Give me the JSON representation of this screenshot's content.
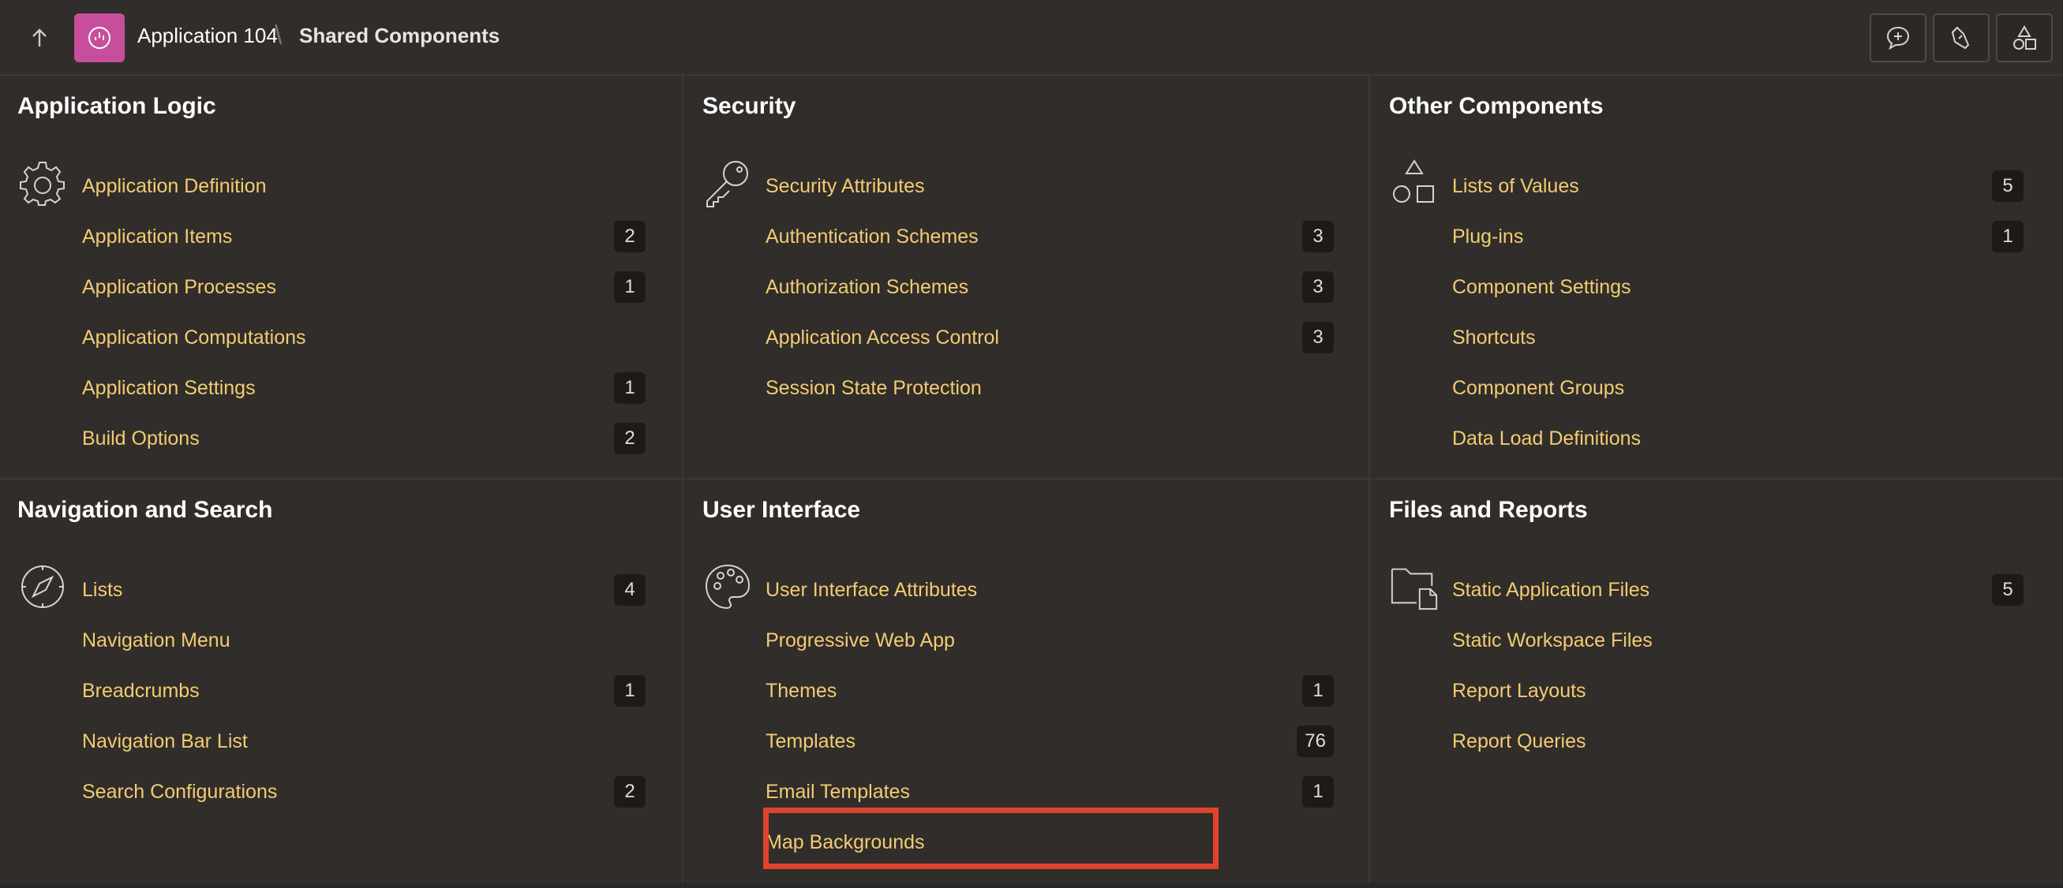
{
  "header": {
    "app_name": "Application 104",
    "separator": "\\",
    "current_page": "Shared Components",
    "buttons": [
      "comment-add-icon",
      "flashlight-icon",
      "shapes-icon"
    ]
  },
  "panels": {
    "application_logic": {
      "title": "Application Logic",
      "icon": "gear-icon",
      "items": [
        {
          "label": "Application Definition",
          "count": ""
        },
        {
          "label": "Application Items",
          "count": "2"
        },
        {
          "label": "Application Processes",
          "count": "1"
        },
        {
          "label": "Application Computations",
          "count": ""
        },
        {
          "label": "Application Settings",
          "count": "1"
        },
        {
          "label": "Build Options",
          "count": "2"
        }
      ]
    },
    "security": {
      "title": "Security",
      "icon": "key-icon",
      "items": [
        {
          "label": "Security Attributes",
          "count": ""
        },
        {
          "label": "Authentication Schemes",
          "count": "3"
        },
        {
          "label": "Authorization Schemes",
          "count": "3"
        },
        {
          "label": "Application Access Control",
          "count": "3"
        },
        {
          "label": "Session State Protection",
          "count": ""
        }
      ]
    },
    "other_components": {
      "title": "Other Components",
      "icon": "shapes-icon",
      "items": [
        {
          "label": "Lists of Values",
          "count": "5"
        },
        {
          "label": "Plug-ins",
          "count": "1"
        },
        {
          "label": "Component Settings",
          "count": ""
        },
        {
          "label": "Shortcuts",
          "count": ""
        },
        {
          "label": "Component Groups",
          "count": ""
        },
        {
          "label": "Data Load Definitions",
          "count": ""
        }
      ]
    },
    "navigation_search": {
      "title": "Navigation and Search",
      "icon": "compass-icon",
      "items": [
        {
          "label": "Lists",
          "count": "4"
        },
        {
          "label": "Navigation Menu",
          "count": ""
        },
        {
          "label": "Breadcrumbs",
          "count": "1"
        },
        {
          "label": "Navigation Bar List",
          "count": ""
        },
        {
          "label": "Search Configurations",
          "count": "2"
        }
      ]
    },
    "user_interface": {
      "title": "User Interface",
      "icon": "palette-icon",
      "items": [
        {
          "label": "User Interface Attributes",
          "count": ""
        },
        {
          "label": "Progressive Web App",
          "count": ""
        },
        {
          "label": "Themes",
          "count": "1"
        },
        {
          "label": "Templates",
          "count": "76"
        },
        {
          "label": "Email Templates",
          "count": "1"
        },
        {
          "label": "Map Backgrounds",
          "count": ""
        }
      ]
    },
    "files_reports": {
      "title": "Files and Reports",
      "icon": "folder-file-icon",
      "items": [
        {
          "label": "Static Application Files",
          "count": "5"
        },
        {
          "label": "Static Workspace Files",
          "count": ""
        },
        {
          "label": "Report Layouts",
          "count": ""
        },
        {
          "label": "Report Queries",
          "count": ""
        }
      ]
    }
  },
  "colors": {
    "background": "#312d2a",
    "link": "#f2cc73",
    "app_badge": "#c74e9d",
    "highlight": "#e0432d"
  }
}
